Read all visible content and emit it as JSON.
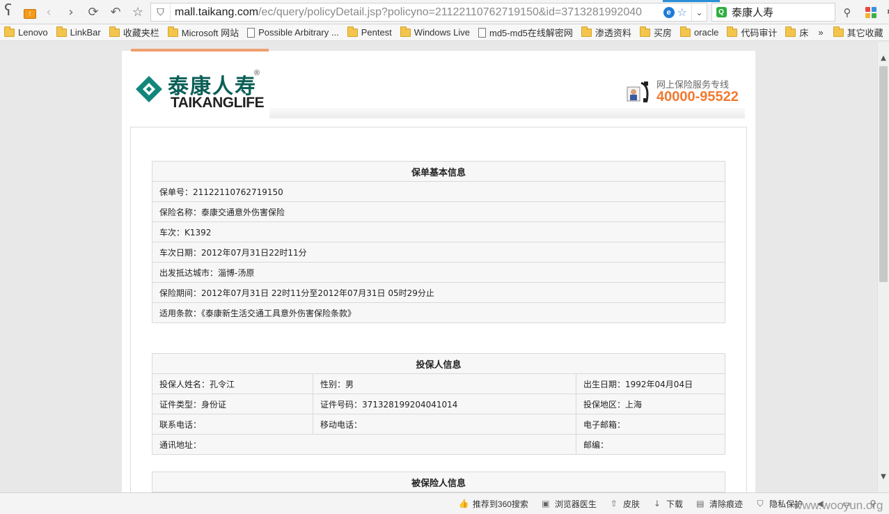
{
  "browser": {
    "url_host": "mall.taikang.com",
    "url_path": "/ec/query/policyDetail.jsp?policyno=21122110762719150&id=3713281992040",
    "search_text": "泰康人寿",
    "accent_color": "#2a8fd6"
  },
  "bookmarks": [
    {
      "label": "Lenovo",
      "type": "folder"
    },
    {
      "label": "LinkBar",
      "type": "folder"
    },
    {
      "label": "收藏夹栏",
      "type": "folder"
    },
    {
      "label": "Microsoft 网站",
      "type": "folder"
    },
    {
      "label": "Possible Arbitrary ...",
      "type": "page"
    },
    {
      "label": "Pentest",
      "type": "folder"
    },
    {
      "label": "Windows Live",
      "type": "folder"
    },
    {
      "label": "md5-md5在线解密网",
      "type": "page"
    },
    {
      "label": "渗透资料",
      "type": "folder"
    },
    {
      "label": "买房",
      "type": "folder"
    },
    {
      "label": "oracle",
      "type": "folder"
    },
    {
      "label": "代码审计",
      "type": "folder"
    },
    {
      "label": "床",
      "type": "folder"
    }
  ],
  "bookmarks_more": "»",
  "bookmarks_other": "其它收藏",
  "site": {
    "logo_cn": "泰康人寿",
    "logo_reg": "®",
    "logo_en": "TAIKANGLIFE",
    "hotline_title": "网上保险服务专线",
    "hotline_number": "40000-95522",
    "brand_color": "#0b5f57",
    "hotline_color": "#f07a30"
  },
  "policy_basic": {
    "title": "保单基本信息",
    "rows": [
      "保单号：21122110762719150",
      "保险名称：泰康交通意外伤害保险",
      "车次：K1392",
      "车次日期：2012年07月31日22时11分",
      "出发抵达城市：淄博-汤原",
      "保险期间：2012年07月31日 22时11分至2012年07月31日 05时29分止",
      "适用条款：《泰康新生活交通工具意外伤害保险条款》"
    ]
  },
  "policyholder": {
    "title": "投保人信息",
    "rows": [
      [
        "投保人姓名：孔令江",
        "性别：男",
        "出生日期：1992年04月04日"
      ],
      [
        "证件类型：身份证",
        "证件号码：371328199204041014",
        "投保地区：上海"
      ],
      [
        "联系电话：",
        "移动电话：",
        "电子邮箱："
      ],
      [
        "通讯地址：",
        "",
        "邮编："
      ]
    ]
  },
  "insured": {
    "title": "被保险人信息"
  },
  "statusbar": {
    "items": [
      "推荐到360搜索",
      "浏览器医生",
      "皮肤",
      "下载",
      "清除痕迹",
      "隐私保护"
    ]
  },
  "watermark": "www.wooyun.org"
}
